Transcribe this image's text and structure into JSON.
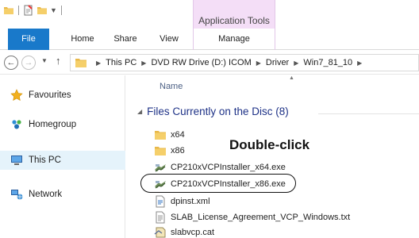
{
  "window": {
    "contextual_tab_group": "Application Tools"
  },
  "ribbon": {
    "tabs": [
      {
        "label": "File"
      },
      {
        "label": "Home"
      },
      {
        "label": "Share"
      },
      {
        "label": "View"
      },
      {
        "label": "Manage"
      }
    ],
    "file_tab_color": "#1979ca",
    "context_color": "#f4def7"
  },
  "address_bar": {
    "crumbs": [
      "This PC",
      "DVD RW Drive (D:) ICOM",
      "Driver",
      "Win7_81_10"
    ]
  },
  "nav_pane": {
    "items": [
      {
        "label": "Favourites",
        "icon": "star-icon"
      },
      {
        "label": "Homegroup",
        "icon": "homegroup-icon"
      },
      {
        "label": "This PC",
        "icon": "computer-icon",
        "selected": true
      },
      {
        "label": "Network",
        "icon": "network-icon"
      }
    ]
  },
  "content": {
    "column_header": "Name",
    "group_title": "Files Currently on the Disc (8)",
    "files": [
      {
        "name": "x64",
        "icon": "folder-icon"
      },
      {
        "name": "x86",
        "icon": "folder-icon"
      },
      {
        "name": "CP210xVCPInstaller_x64.exe",
        "icon": "installer-icon"
      },
      {
        "name": "CP210xVCPInstaller_x86.exe",
        "icon": "installer-icon",
        "highlighted": true
      },
      {
        "name": "dpinst.xml",
        "icon": "xml-file-icon"
      },
      {
        "name": "SLAB_License_Agreement_VCP_Windows.txt",
        "icon": "text-file-icon"
      },
      {
        "name": "slabvcp.cat",
        "icon": "catalog-file-icon"
      }
    ],
    "annotation": "Double-click"
  }
}
